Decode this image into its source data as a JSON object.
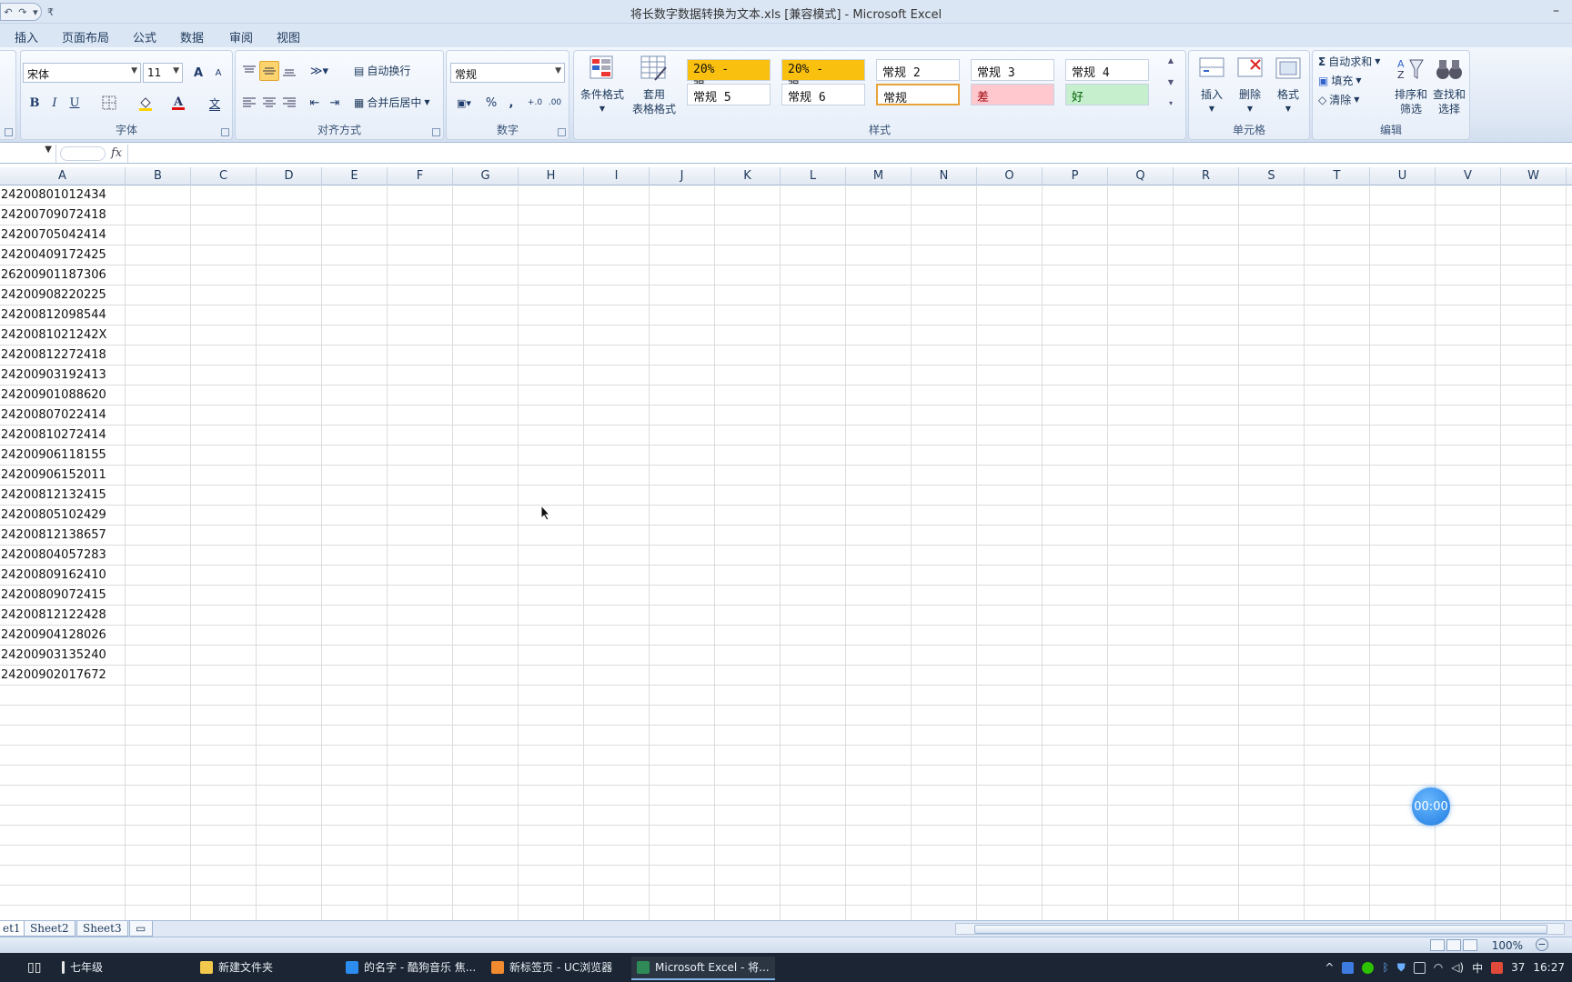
{
  "window": {
    "title": "将长数字数据转换为文本.xls [兼容模式] - Microsoft Excel",
    "min_glyph": "–"
  },
  "qat": {
    "undo_glyph": "↶",
    "redo_glyph": "↷",
    "dropdown_glyph": "▾",
    "more_glyph": "₹"
  },
  "ribbon_tabs": [
    "插入",
    "页面布局",
    "公式",
    "数据",
    "审阅",
    "视图"
  ],
  "font_group": {
    "label": "字体",
    "font_name": "宋体",
    "font_size": "11",
    "grow": "A",
    "shrink": "A",
    "bold": "B",
    "italic": "I",
    "underline": "U",
    "wen": "文"
  },
  "align_group": {
    "label": "对齐方式",
    "wrap_text": "自动换行",
    "merge_center": "合并后居中"
  },
  "number_group": {
    "label": "数字",
    "format": "常规",
    "percent": "%",
    "comma": ",",
    "inc_decimal": "+.0",
    "dec_decimal": ".00"
  },
  "styles_group": {
    "label": "样式",
    "conditional_format": "条件格式",
    "table_format_1": "套用",
    "table_format_2": "表格格式",
    "cells": [
      {
        "text": "20% - 强...",
        "bg": "#f9c010"
      },
      {
        "text": "20% - 强...",
        "bg": "#f9c010"
      },
      {
        "text": "常规 2",
        "bg": "#ffffff"
      },
      {
        "text": "常规 3",
        "bg": "#ffffff"
      },
      {
        "text": "常规 4",
        "bg": "#ffffff"
      },
      {
        "text": "常规 5",
        "bg": "#ffffff"
      },
      {
        "text": "常规 6",
        "bg": "#ffffff"
      },
      {
        "text": "常规",
        "bg": "#ffffff"
      },
      {
        "text": "差",
        "bg": "#ffc7ce"
      },
      {
        "text": "好",
        "bg": "#c6efce"
      }
    ]
  },
  "cells_group": {
    "label": "单元格",
    "insert": "插入",
    "delete": "删除",
    "format": "格式"
  },
  "edit_group": {
    "label": "编辑",
    "autosum": "自动求和",
    "fill": "填充",
    "clear": "清除",
    "sort_filter_1": "排序和",
    "sort_filter_2": "筛选",
    "find_select_1": "查找和",
    "find_select_2": "选择"
  },
  "formula_bar": {
    "fx": "fx",
    "content": ""
  },
  "columns": [
    "A",
    "B",
    "C",
    "D",
    "E",
    "F",
    "G",
    "H",
    "I",
    "J",
    "K",
    "L",
    "M",
    "N",
    "O",
    "P",
    "Q",
    "R",
    "S",
    "T",
    "U",
    "V",
    "W"
  ],
  "column_a_values": [
    "24200801012434",
    "24200709072418",
    "24200705042414",
    "24200409172425",
    "26200901187306",
    "24200908220225",
    "24200812098544",
    "2420081021242X",
    "24200812272418",
    "24200903192413",
    "24200901088620",
    "24200807022414",
    "24200810272414",
    "24200906118155",
    "24200906152011",
    "24200812132415",
    "24200805102429",
    "24200812138657",
    "24200804057283",
    "24200809162410",
    "24200809072415",
    "24200812122428",
    "24200904128026",
    "24200903135240",
    "24200902017672"
  ],
  "sheet_tabs": [
    "et1",
    "Sheet2",
    "Sheet3"
  ],
  "status": {
    "zoom": "100%"
  },
  "recorder": {
    "time": "00:00"
  },
  "taskbar": {
    "items": [
      {
        "label": "七年级",
        "color": "#e7e7e7"
      },
      {
        "label": "新建文件夹",
        "color": "#f2c94c"
      },
      {
        "label": "的名字 - 酷狗音乐 焦...",
        "color": "#2d8cf0"
      },
      {
        "label": "新标签页 - UC浏览器",
        "color": "#f28a30"
      },
      {
        "label": "Microsoft Excel - 将...",
        "color": "#2e8b57"
      }
    ],
    "ime": "中",
    "date": "37",
    "clock": "16:27"
  }
}
